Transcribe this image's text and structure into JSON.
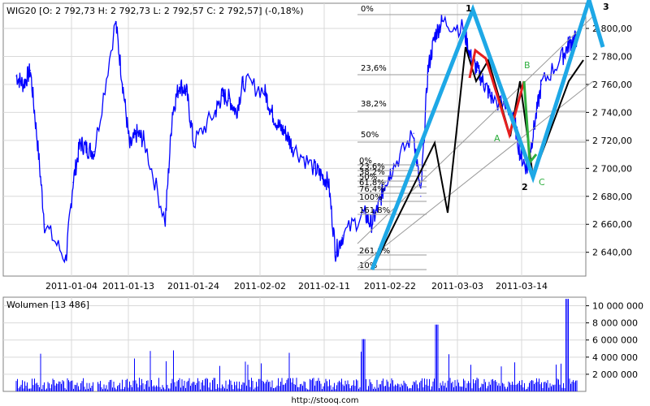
{
  "chart_data": [
    {
      "type": "line",
      "title": "WIG20 [O: 2 792,73  H: 2 792,73  L: 2 792,57  C: 2 792,57] (-0,18%)",
      "x_tick_labels": [
        "2011-01-04",
        "2011-01-13",
        "2011-01-24",
        "2011-02-02",
        "2011-02-11",
        "2011-02-22",
        "2011-03-03",
        "2011-03-14"
      ],
      "y_tick_labels": [
        "2 640,00",
        "2 660,00",
        "2 680,00",
        "2 700,00",
        "2 720,00",
        "2 740,00",
        "2 760,00",
        "2 780,00",
        "2 800,00"
      ],
      "y_ticks": [
        2640,
        2660,
        2680,
        2700,
        2720,
        2740,
        2760,
        2780,
        2800
      ],
      "ylim": [
        2623,
        2818
      ],
      "grid": true,
      "series": [
        {
          "color": "#0000ff",
          "x": [
            "2011-01-03",
            "2011-01-04",
            "2011-01-05",
            "2011-01-06",
            "2011-01-07",
            "2011-01-10",
            "2011-01-11",
            "2011-01-12",
            "2011-01-13",
            "2011-01-14",
            "2011-01-17",
            "2011-01-18",
            "2011-01-19",
            "2011-01-20",
            "2011-01-21",
            "2011-01-24",
            "2011-01-25",
            "2011-01-26",
            "2011-01-27",
            "2011-01-28",
            "2011-01-31",
            "2011-02-01",
            "2011-02-02",
            "2011-02-03",
            "2011-02-04",
            "2011-02-07",
            "2011-02-08",
            "2011-02-09",
            "2011-02-10",
            "2011-02-11",
            "2011-02-14",
            "2011-02-15",
            "2011-02-16",
            "2011-02-17",
            "2011-02-18",
            "2011-02-21",
            "2011-02-22",
            "2011-02-23",
            "2011-02-24",
            "2011-02-25",
            "2011-02-28",
            "2011-03-01",
            "2011-03-02",
            "2011-03-03",
            "2011-03-04",
            "2011-03-07",
            "2011-03-08",
            "2011-03-09",
            "2011-03-10",
            "2011-03-11",
            "2011-03-14",
            "2011-03-15",
            "2011-03-16",
            "2011-03-17",
            "2011-03-18",
            "2011-03-21",
            "2011-03-22",
            "2011-03-23"
          ],
          "values": [
            2766,
            2760,
            2770,
            2718,
            2660,
            2635,
            2690,
            2718,
            2714,
            2712,
            2805,
            2760,
            2715,
            2725,
            2720,
            2662,
            2740,
            2760,
            2755,
            2718,
            2740,
            2752,
            2750,
            2740,
            2762,
            2755,
            2740,
            2730,
            2725,
            2715,
            2700,
            2695,
            2690,
            2640,
            2652,
            2668,
            2660,
            2672,
            2690,
            2700,
            2725,
            2680,
            2770,
            2795,
            2805,
            2800,
            2780,
            2770,
            2760,
            2750,
            2740,
            2710,
            2700,
            2730,
            2760,
            2780,
            2790,
            2793
          ]
        }
      ],
      "fib_levels_left": [
        "0%",
        "23,6%",
        "38,2%",
        "50%"
      ],
      "fib_levels_mid": [
        "0%",
        "23,6%",
        "38,2%",
        "50%",
        "61,8%",
        "76,4%",
        "100%",
        "161,8%",
        "261,8%",
        "10%"
      ],
      "wave_labels": {
        "w1": "1",
        "w2": "2",
        "w3": "3",
        "wA": "A",
        "wB": "B",
        "wC": "C"
      },
      "overlay_colors": {
        "price": "#0000ff",
        "wave": "#1ea8e6",
        "impulse": "#000000",
        "correction": "#e61e1e",
        "recovery": "#2eae3e"
      }
    },
    {
      "type": "bar",
      "title": "Wolumen [13 486]",
      "y_tick_labels": [
        "2 000 000",
        "4 000 000",
        "6 000 000",
        "8 000 000",
        "10 000 000"
      ],
      "y_ticks": [
        2000000,
        4000000,
        6000000,
        8000000,
        10000000
      ],
      "ylim": [
        0,
        11000000
      ],
      "grid": true,
      "color": "#0000ff"
    }
  ],
  "footer": "http://stooq.com"
}
